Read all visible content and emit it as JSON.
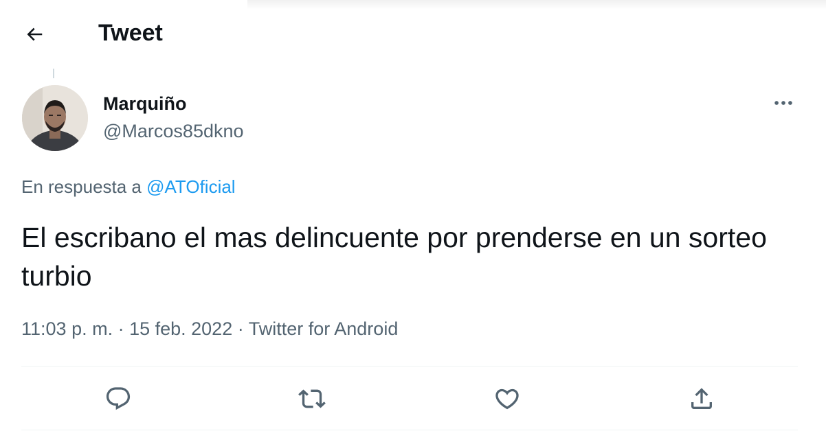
{
  "header": {
    "title": "Tweet",
    "back_icon": "arrow-left-icon"
  },
  "tweet": {
    "author": {
      "display_name": "Marquiño",
      "handle": "@Marcos85dkno"
    },
    "reply_context": {
      "prefix": "En respuesta a ",
      "mention": "@ATOficial"
    },
    "text": "El escribano el mas delincuente por prenderse en un sorteo turbio",
    "time": "11:03 p. m.",
    "separator": " · ",
    "date": "15 feb. 2022",
    "source": "Twitter for Android",
    "more_icon": "more-horizontal-icon"
  },
  "actions": {
    "icons": [
      "reply-icon",
      "retweet-icon",
      "like-icon",
      "share-icon"
    ]
  },
  "colors": {
    "text_primary": "#0f1419",
    "text_secondary": "#536471",
    "link": "#1d9bf0",
    "divider": "#eff3f4"
  }
}
